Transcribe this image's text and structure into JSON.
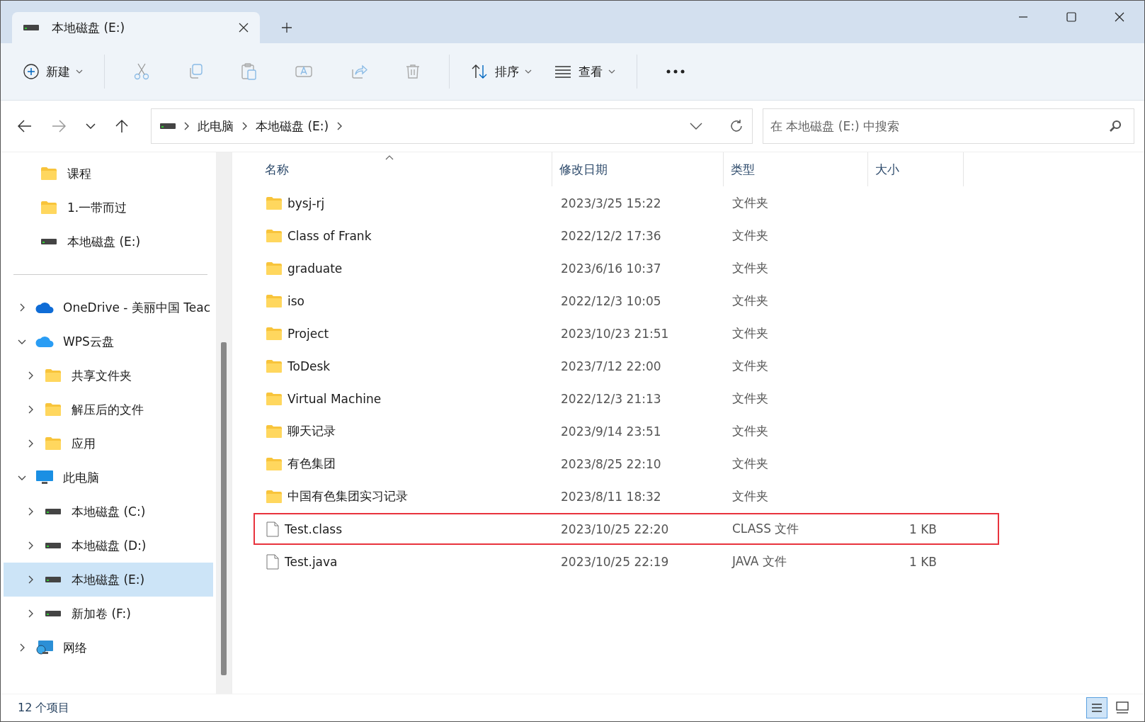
{
  "tab": {
    "title": "本地磁盘 (E:)"
  },
  "toolbar": {
    "new": "新建",
    "sort": "排序",
    "view": "查看"
  },
  "address": {
    "crumbs": [
      "此电脑",
      "本地磁盘 (E:)"
    ],
    "search_placeholder": "在 本地磁盘 (E:) 中搜索"
  },
  "sidebar": {
    "pinned": [
      {
        "label": "课程",
        "kind": "folder"
      },
      {
        "label": "1.一带而过",
        "kind": "folder"
      },
      {
        "label": "本地磁盘 (E:)",
        "kind": "drive"
      }
    ],
    "tree": [
      {
        "label": "OneDrive - 美丽中国 Teac",
        "kind": "onedrive",
        "expanded": false,
        "selected": false
      },
      {
        "label": "WPS云盘",
        "kind": "cloud",
        "expanded": true,
        "selected": false,
        "children": [
          {
            "label": "共享文件夹",
            "kind": "folder",
            "expanded": false,
            "selected": false
          },
          {
            "label": "解压后的文件",
            "kind": "folder",
            "expanded": false,
            "selected": false
          },
          {
            "label": "应用",
            "kind": "folder",
            "expanded": false,
            "selected": false
          }
        ]
      },
      {
        "label": "此电脑",
        "kind": "pc",
        "expanded": true,
        "selected": false,
        "children": [
          {
            "label": "本地磁盘 (C:)",
            "kind": "drive",
            "expanded": false,
            "selected": false
          },
          {
            "label": "本地磁盘 (D:)",
            "kind": "drive",
            "expanded": false,
            "selected": false
          },
          {
            "label": "本地磁盘 (E:)",
            "kind": "drive",
            "expanded": false,
            "selected": true
          },
          {
            "label": "新加卷 (F:)",
            "kind": "drive",
            "expanded": false,
            "selected": false
          }
        ]
      },
      {
        "label": "网络",
        "kind": "network",
        "expanded": false,
        "selected": false
      }
    ]
  },
  "table": {
    "columns": [
      "名称",
      "修改日期",
      "类型",
      "大小"
    ],
    "rows": [
      {
        "kind": "folder",
        "name": "bysj-rj",
        "date": "2023/3/25 15:22",
        "type": "文件夹",
        "highlighted": false
      },
      {
        "kind": "folder",
        "name": "Class of Frank",
        "date": "2022/12/2 17:36",
        "type": "文件夹",
        "highlighted": false
      },
      {
        "kind": "folder",
        "name": "graduate",
        "date": "2023/6/16 10:37",
        "type": "文件夹",
        "highlighted": false
      },
      {
        "kind": "folder",
        "name": "iso",
        "date": "2022/12/3 10:05",
        "type": "文件夹",
        "highlighted": false
      },
      {
        "kind": "folder",
        "name": "Project",
        "date": "2023/10/23 21:51",
        "type": "文件夹",
        "highlighted": false
      },
      {
        "kind": "folder",
        "name": "ToDesk",
        "date": "2023/7/12 22:00",
        "type": "文件夹",
        "highlighted": false
      },
      {
        "kind": "folder",
        "name": "Virtual Machine",
        "date": "2022/12/3 21:13",
        "type": "文件夹",
        "highlighted": false
      },
      {
        "kind": "folder",
        "name": "聊天记录",
        "date": "2023/9/14 23:51",
        "type": "文件夹",
        "highlighted": false
      },
      {
        "kind": "folder",
        "name": "有色集团",
        "date": "2023/8/25 22:10",
        "type": "文件夹",
        "highlighted": false
      },
      {
        "kind": "folder",
        "name": "中国有色集团实习记录",
        "date": "2023/8/11 18:32",
        "type": "文件夹",
        "highlighted": false
      },
      {
        "kind": "file",
        "name": "Test.class",
        "date": "2023/10/25 22:20",
        "type": "CLASS 文件",
        "size": "1 KB",
        "highlighted": true
      },
      {
        "kind": "file",
        "name": "Test.java",
        "date": "2023/10/25 22:19",
        "type": "JAVA 文件",
        "size": "1 KB",
        "highlighted": false
      }
    ]
  },
  "status_bar": {
    "count": "12 个项目"
  }
}
